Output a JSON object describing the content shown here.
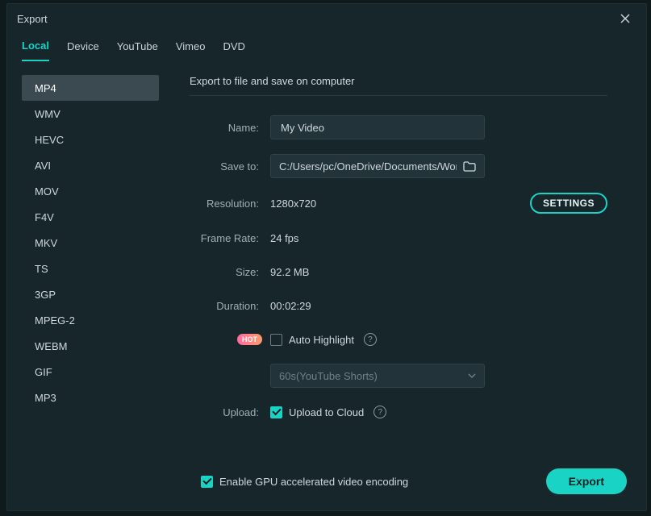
{
  "window": {
    "title": "Export"
  },
  "tabs": [
    {
      "label": "Local",
      "active": true
    },
    {
      "label": "Device",
      "active": false
    },
    {
      "label": "YouTube",
      "active": false
    },
    {
      "label": "Vimeo",
      "active": false
    },
    {
      "label": "DVD",
      "active": false
    }
  ],
  "formats": [
    "MP4",
    "WMV",
    "HEVC",
    "AVI",
    "MOV",
    "F4V",
    "MKV",
    "TS",
    "3GP",
    "MPEG-2",
    "WEBM",
    "GIF",
    "MP3"
  ],
  "formats_active_index": 0,
  "section_title": "Export to file and save on computer",
  "labels": {
    "name": "Name:",
    "save_to": "Save to:",
    "resolution": "Resolution:",
    "frame_rate": "Frame Rate:",
    "size": "Size:",
    "duration": "Duration:",
    "upload": "Upload:"
  },
  "fields": {
    "name_value": "My Video",
    "save_to_path": "C:/Users/pc/OneDrive/Documents/Wond",
    "resolution": "1280x720",
    "frame_rate": "24 fps",
    "size": "92.2 MB",
    "duration": "00:02:29",
    "auto_highlight_label": "Auto Highlight",
    "hot_badge": "HOT",
    "preset_selected": "60s(YouTube Shorts)",
    "upload_label": "Upload to Cloud",
    "upload_checked": true,
    "auto_highlight_checked": false
  },
  "buttons": {
    "settings": "SETTINGS",
    "export": "Export"
  },
  "footer": {
    "gpu_label": "Enable GPU accelerated video encoding",
    "gpu_checked": true
  }
}
